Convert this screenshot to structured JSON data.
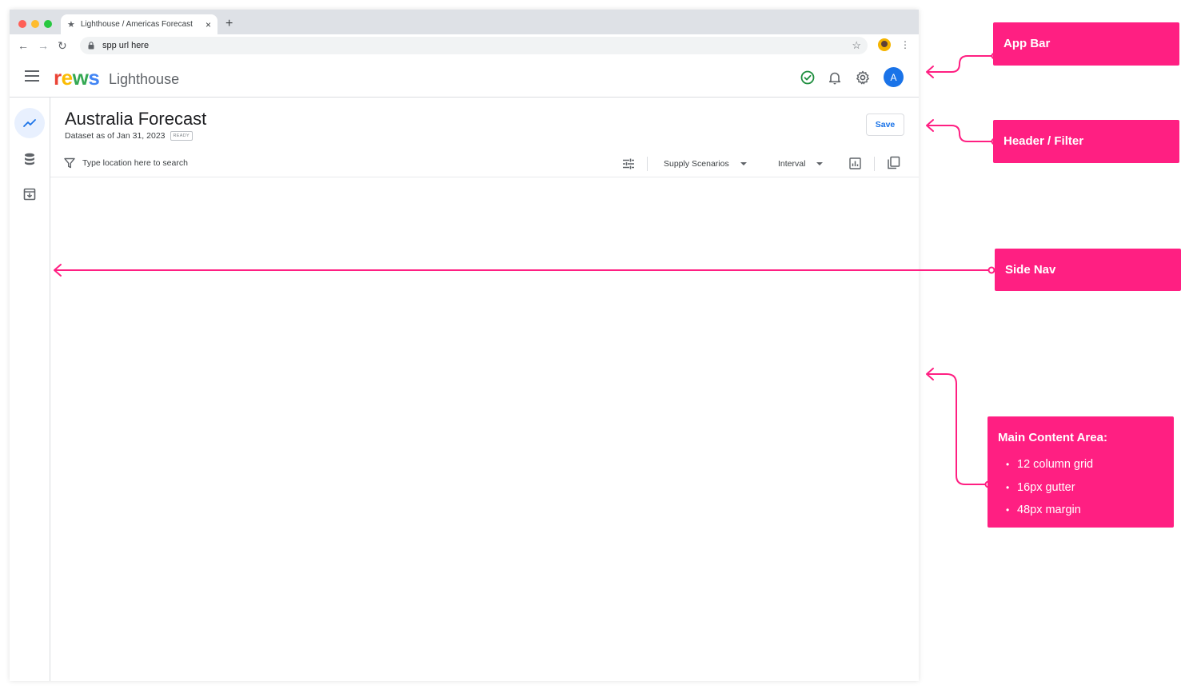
{
  "browser": {
    "tab_title": "Lighthouse / Americas Forecast",
    "tab_close": "×",
    "new_tab": "+",
    "url": "spp url here",
    "nav_back": "←",
    "nav_forward": "→",
    "nav_reload": "↻",
    "bookmark": "☆",
    "menu": "⋮"
  },
  "appbar": {
    "logo_letters": [
      "r",
      "e",
      "w",
      "s"
    ],
    "app_name": "Lighthouse",
    "avatar_initial": "A"
  },
  "header": {
    "title": "Australia Forecast",
    "dataset_label": "Dataset as of Jan 31, 2023",
    "status_badge": "READY",
    "save_label": "Save"
  },
  "filter": {
    "search_placeholder": "Type location here to search",
    "scenario_dropdown": "Supply Scenarios",
    "interval_dropdown": "Interval"
  },
  "sidenav": {
    "items": [
      "forecast",
      "data",
      "archive"
    ],
    "active": "forecast"
  },
  "annotations": {
    "app_bar": "App Bar",
    "header_filter": "Header / Filter",
    "side_nav": "Side Nav",
    "main_content": {
      "title": "Main Content Area:",
      "bullets": [
        "12 column grid",
        "16px gutter",
        "48px margin"
      ]
    }
  },
  "colors": {
    "accent": "#1a73e8",
    "annotation": "#ff1f82",
    "success": "#1e8e3e",
    "sidenav_active_bg": "#e8f0fe"
  }
}
